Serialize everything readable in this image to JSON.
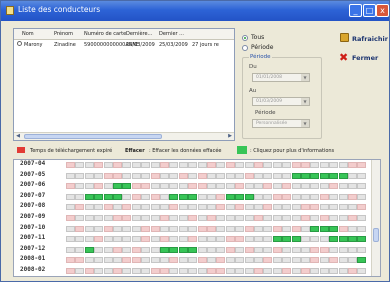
{
  "window": {
    "title": "Liste des conducteurs",
    "controls": {
      "minimize": "_",
      "maximize": "□",
      "close": "x"
    }
  },
  "table": {
    "columns": [
      "Nom",
      "Prénom",
      "Numéro de carte",
      "Dernière...",
      "Dernier ...",
      ""
    ],
    "rows": [
      {
        "cells": [
          "Marony",
          "Zinadine",
          "5900000000000ARNE",
          "25/03/2009",
          "25/03/2009",
          "27 jours re"
        ]
      }
    ]
  },
  "filter": {
    "all_label": "Tous",
    "period_label": "Période",
    "period_group_title": "Période",
    "from_label": "Du",
    "from_value": "01/01/2008",
    "to_label": "Au",
    "to_value": "01/03/2009",
    "period_sub_label": "Période",
    "period_value": "Personnalisée"
  },
  "actions": {
    "refresh_label": "Rafraichir",
    "close_label": "Fermer"
  },
  "legend": {
    "overdue_text": "Temps de téléchargement expiré",
    "erase_label": "Effacer",
    "erase_text": ": Effacer les données effacée",
    "click_text": ": Cliquez pour plus d'informations",
    "colors": {
      "overdue": "#e23b34",
      "info": "#37c557",
      "neutral": "#e4e4e4",
      "light_pink": "#f3cdcd"
    }
  },
  "calendar": {
    "months": [
      "2007-04",
      "2007-05",
      "2007-06",
      "2007-07",
      "2007-08",
      "2007-09",
      "2007-10",
      "2007-11",
      "2007-12",
      "2008-01",
      "2008-02"
    ]
  }
}
